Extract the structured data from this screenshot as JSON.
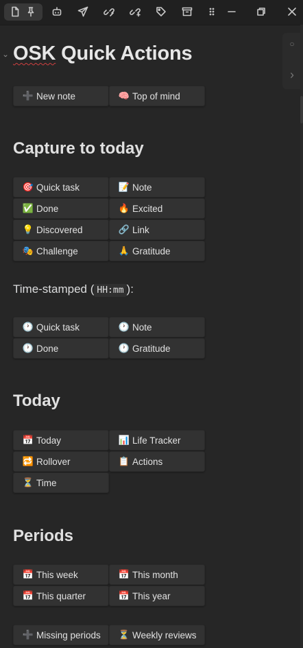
{
  "toolbar": {
    "icons": [
      "file-icon",
      "pin-icon",
      "robot-icon",
      "send-icon",
      "link-edit-icon",
      "link-share-icon",
      "tag-icon",
      "archive-icon",
      "grip-icon",
      "minimize-icon",
      "restore-icon",
      "close-icon"
    ]
  },
  "side": {
    "dot": "○",
    "chevron": "›"
  },
  "page": {
    "fold_glyph": "⌄",
    "title_a": "OSK",
    "title_b": " Quick Actions"
  },
  "quick": [
    {
      "icon": "➕",
      "label": "New note"
    },
    {
      "icon": "🧠",
      "label": "Top of mind"
    }
  ],
  "capture": {
    "heading": "Capture to today",
    "buttons": [
      {
        "icon": "🎯",
        "label": "Quick task"
      },
      {
        "icon": "📝",
        "label": "Note"
      },
      {
        "icon": "✅",
        "label": "Done"
      },
      {
        "icon": "🔥",
        "label": "Excited"
      },
      {
        "icon": "💡",
        "label": "Discovered"
      },
      {
        "icon": "🔗",
        "label": "Link"
      },
      {
        "icon": "🎭",
        "label": "Challenge"
      },
      {
        "icon": "🙏",
        "label": "Gratitude"
      }
    ]
  },
  "timestamped": {
    "prefix": "Time-stamped (",
    "code": "HH:mm",
    "suffix": "):",
    "buttons": [
      {
        "icon": "🕐",
        "label": "Quick task"
      },
      {
        "icon": "🕐",
        "label": "Note"
      },
      {
        "icon": "🕐",
        "label": "Done"
      },
      {
        "icon": "🕐",
        "label": "Gratitude"
      }
    ]
  },
  "today": {
    "heading": "Today",
    "buttons": [
      {
        "icon": "📅",
        "label": "Today"
      },
      {
        "icon": "📊",
        "label": "Life Tracker"
      },
      {
        "icon": "🔁",
        "label": "Rollover"
      },
      {
        "icon": "📋",
        "label": "Actions"
      },
      {
        "icon": "⏳",
        "label": "Time"
      }
    ]
  },
  "periods": {
    "heading": "Periods",
    "buttons": [
      {
        "icon": "📅",
        "label": "This week"
      },
      {
        "icon": "📅",
        "label": "This month"
      },
      {
        "icon": "📅",
        "label": "This quarter"
      },
      {
        "icon": "📅",
        "label": "This year"
      }
    ],
    "extra": [
      {
        "icon": "➕",
        "label": "Missing periods"
      },
      {
        "icon": "⏳",
        "label": "Weekly reviews"
      }
    ]
  }
}
